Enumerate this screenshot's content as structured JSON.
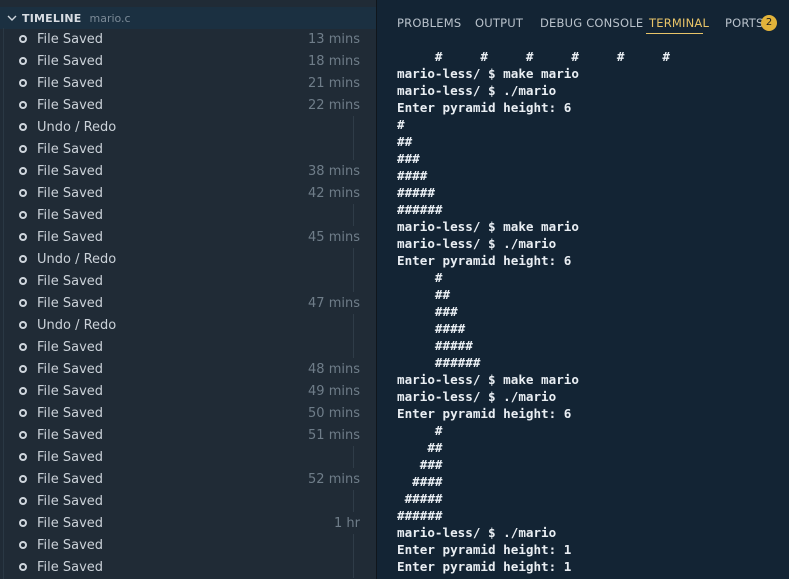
{
  "timeline": {
    "title": "TIMELINE",
    "file": "mario.c",
    "entries": [
      {
        "label": "File Saved",
        "time": "13 mins"
      },
      {
        "label": "File Saved",
        "time": "18 mins"
      },
      {
        "label": "File Saved",
        "time": "21 mins"
      },
      {
        "label": "File Saved",
        "time": "22 mins"
      },
      {
        "label": "Undo / Redo",
        "time": ""
      },
      {
        "label": "File Saved",
        "time": ""
      },
      {
        "label": "File Saved",
        "time": "38 mins"
      },
      {
        "label": "File Saved",
        "time": "42 mins"
      },
      {
        "label": "File Saved",
        "time": ""
      },
      {
        "label": "File Saved",
        "time": "45 mins"
      },
      {
        "label": "Undo / Redo",
        "time": ""
      },
      {
        "label": "File Saved",
        "time": ""
      },
      {
        "label": "File Saved",
        "time": "47 mins"
      },
      {
        "label": "Undo / Redo",
        "time": ""
      },
      {
        "label": "File Saved",
        "time": ""
      },
      {
        "label": "File Saved",
        "time": "48 mins"
      },
      {
        "label": "File Saved",
        "time": "49 mins"
      },
      {
        "label": "File Saved",
        "time": "50 mins"
      },
      {
        "label": "File Saved",
        "time": "51 mins"
      },
      {
        "label": "File Saved",
        "time": ""
      },
      {
        "label": "File Saved",
        "time": "52 mins"
      },
      {
        "label": "File Saved",
        "time": ""
      },
      {
        "label": "File Saved",
        "time": "1 hr"
      },
      {
        "label": "File Saved",
        "time": ""
      },
      {
        "label": "File Saved",
        "time": ""
      }
    ]
  },
  "panel": {
    "tabs": {
      "problems": "PROBLEMS",
      "output": "OUTPUT",
      "debug_console": "DEBUG CONSOLE",
      "terminal": "TERMINAL",
      "ports": "PORTS"
    },
    "ports_badge": "2",
    "active_tab": "TERMINAL",
    "accent_color": "#e8c468"
  },
  "terminal": {
    "lines": [
      "     #     #     #     #     #     #",
      "mario-less/ $ make mario",
      "mario-less/ $ ./mario",
      "Enter pyramid height: 6",
      "#",
      "##",
      "###",
      "####",
      "#####",
      "######",
      "mario-less/ $ make mario",
      "mario-less/ $ ./mario",
      "Enter pyramid height: 6",
      "     #",
      "     ##",
      "     ###",
      "     ####",
      "     #####",
      "     ######",
      "mario-less/ $ make mario",
      "mario-less/ $ ./mario",
      "Enter pyramid height: 6",
      "     #",
      "    ##",
      "   ###",
      "  ####",
      " #####",
      "######",
      "mario-less/ $ ./mario",
      "Enter pyramid height: 1",
      "Enter pyramid height: 1"
    ]
  }
}
